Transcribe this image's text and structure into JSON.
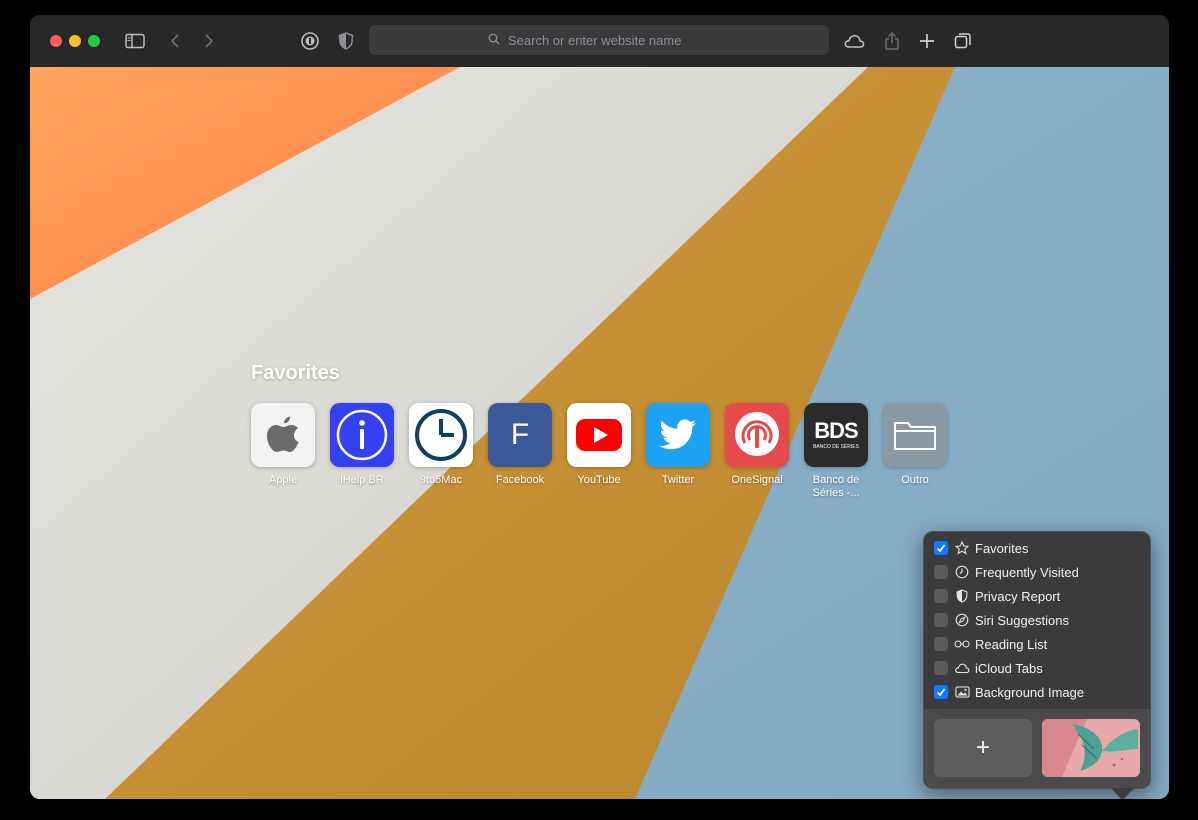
{
  "toolbar": {
    "address_placeholder": "Search or enter website name",
    "icons": [
      "sidebar-icon",
      "back-icon",
      "forward-icon",
      "password-icon",
      "privacy-shield-icon",
      "search-icon",
      "icloud-icon",
      "share-icon",
      "new-tab-icon",
      "tab-overview-icon"
    ]
  },
  "start_page": {
    "favorites_title": "Favorites",
    "favorites": [
      {
        "label": "Apple",
        "icon": "apple-logo-icon"
      },
      {
        "label": "iHelp BR",
        "icon": "info-icon"
      },
      {
        "label": "9to5Mac",
        "icon": "clock-icon"
      },
      {
        "label": "Facebook",
        "icon": "letter-f-icon",
        "letter": "F"
      },
      {
        "label": "YouTube",
        "icon": "youtube-play-icon"
      },
      {
        "label": "Twitter",
        "icon": "twitter-bird-icon"
      },
      {
        "label": "OneSignal",
        "icon": "onesignal-icon"
      },
      {
        "label": "Banco de Séries -...",
        "icon": "bds-logo-icon",
        "logo_text": "BDS",
        "logo_subtext": "BANCO DE SÉRIES"
      },
      {
        "label": "Outro",
        "icon": "folder-icon"
      }
    ]
  },
  "customize_menu": {
    "options": [
      {
        "label": "Favorites",
        "checked": true,
        "icon": "star-icon"
      },
      {
        "label": "Frequently Visited",
        "checked": false,
        "icon": "clock-icon"
      },
      {
        "label": "Privacy Report",
        "checked": false,
        "icon": "shield-icon"
      },
      {
        "label": "Siri Suggestions",
        "checked": false,
        "icon": "compass-icon"
      },
      {
        "label": "Reading List",
        "checked": false,
        "icon": "glasses-icon"
      },
      {
        "label": "iCloud Tabs",
        "checked": false,
        "icon": "cloud-icon"
      },
      {
        "label": "Background Image",
        "checked": true,
        "icon": "image-icon"
      }
    ],
    "add_background_label": "+"
  },
  "colors": {
    "accent": "#0a7aff",
    "bg_orange": "#ff9a55",
    "bg_cream": "#dddcd6",
    "bg_gold": "#c69137",
    "bg_blue": "#89afc8"
  }
}
